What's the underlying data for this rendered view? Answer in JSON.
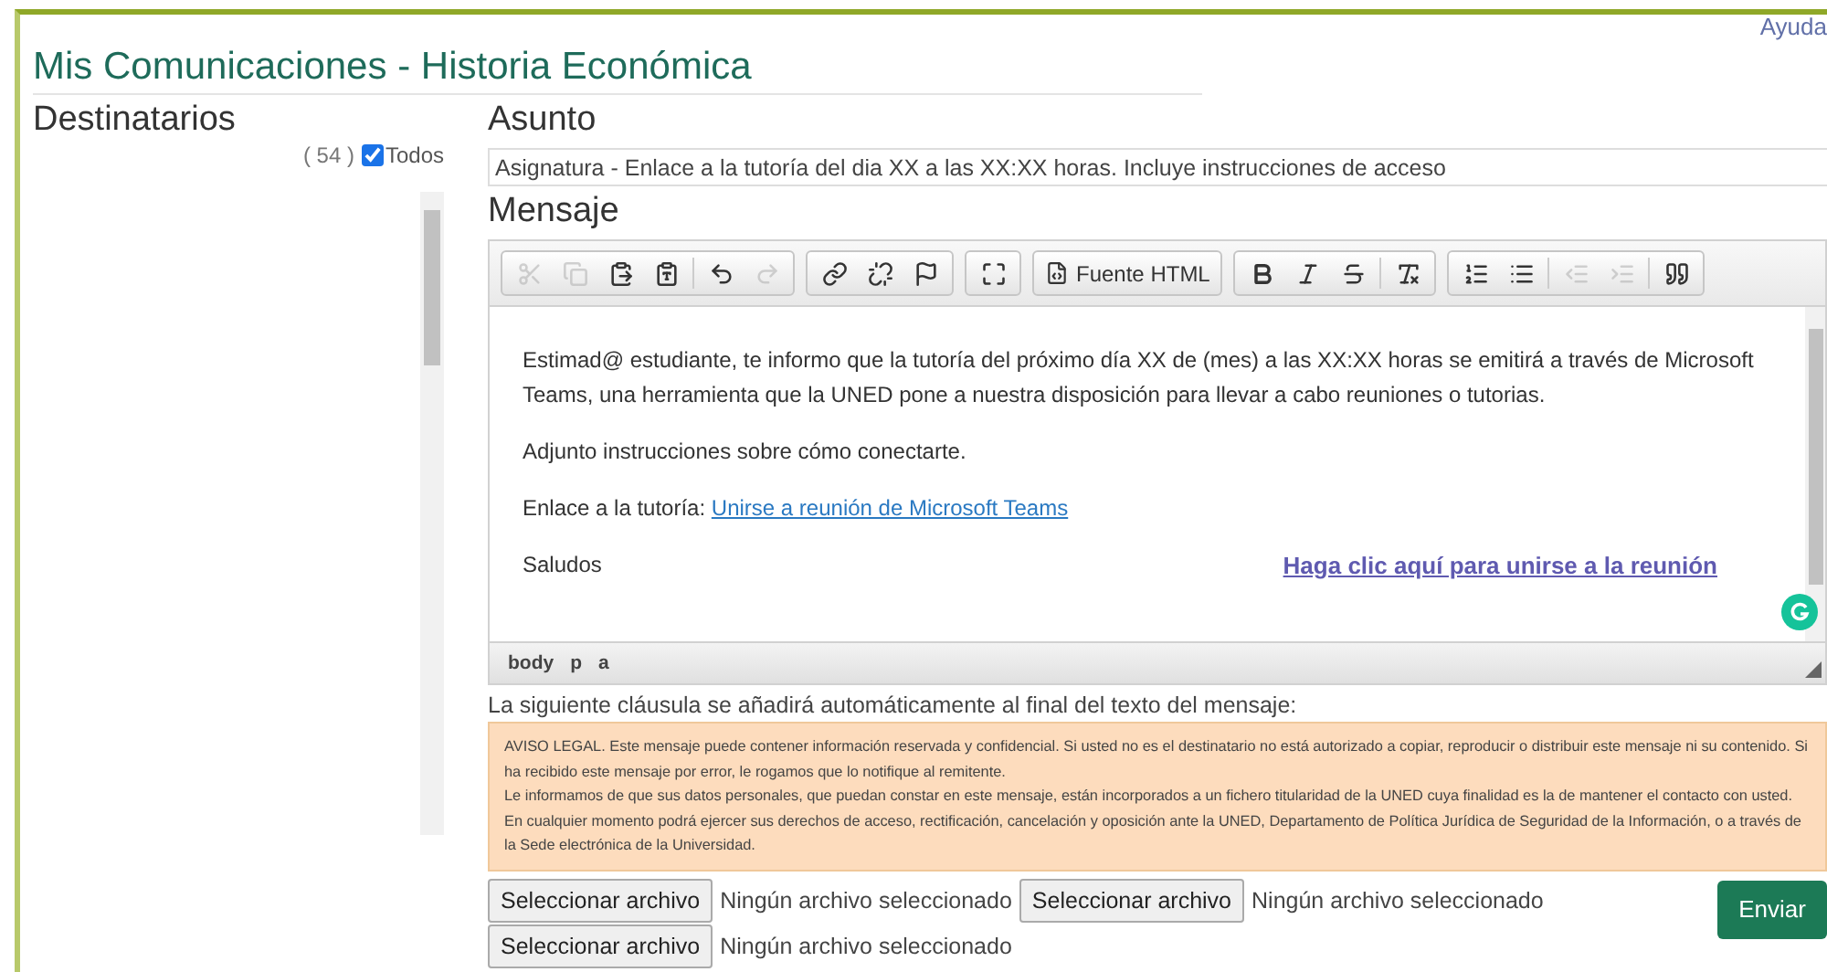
{
  "help_link": "Ayuda",
  "title": "Mis Comunicaciones - Historia Económica",
  "recipients": {
    "heading": "Destinatarios",
    "count": "( 54 )",
    "select_all": {
      "label": "Todos",
      "checked": true
    }
  },
  "subject": {
    "heading": "Asunto",
    "value": "Asignatura - Enlace a la tutoría del dia XX a las XX:XX horas. Incluye instrucciones de acceso"
  },
  "message": {
    "heading": "Mensaje",
    "toolbar": [
      [
        {
          "kind": "cut",
          "disabled": true
        },
        {
          "kind": "copy",
          "disabled": true
        },
        {
          "kind": "paste",
          "disabled": false
        },
        {
          "kind": "pasteword",
          "disabled": false
        },
        {
          "kind": "sep"
        },
        {
          "kind": "undo",
          "disabled": false
        },
        {
          "kind": "redo",
          "disabled": true
        }
      ],
      [
        {
          "kind": "link",
          "disabled": false
        },
        {
          "kind": "unlink",
          "disabled": false
        },
        {
          "kind": "anchor",
          "disabled": false
        }
      ],
      [
        {
          "kind": "maximize",
          "disabled": false
        }
      ],
      [
        {
          "kind": "source",
          "label": "Fuente HTML",
          "disabled": false
        }
      ],
      [
        {
          "kind": "bold",
          "disabled": false
        },
        {
          "kind": "italic",
          "disabled": false
        },
        {
          "kind": "strike",
          "disabled": false
        },
        {
          "kind": "sep"
        },
        {
          "kind": "clearformat",
          "disabled": false
        }
      ],
      [
        {
          "kind": "numbered",
          "disabled": false
        },
        {
          "kind": "bulleted",
          "disabled": false
        },
        {
          "kind": "sep"
        },
        {
          "kind": "outdent",
          "disabled": true
        },
        {
          "kind": "indent",
          "disabled": true
        },
        {
          "kind": "sep"
        },
        {
          "kind": "quote",
          "disabled": false
        }
      ]
    ],
    "paragraphs": [
      {
        "text": "Estimad@ estudiante, te informo que la tutoría del próximo día XX de (mes) a las XX:XX horas se emitirá a través de  Microsoft Teams, una herramienta que la UNED pone a nuestra disposición para llevar a cabo reuniones o tutorias."
      },
      {
        "text": "Adjunto instrucciones sobre cómo conectarte."
      },
      {
        "text": "Enlace a la tutoría:",
        "link": "Unirse a reunión de Microsoft Teams"
      },
      {
        "text": "Saludos",
        "join_link": "Haga clic aquí para unirse a la reunión"
      }
    ],
    "path": [
      "body",
      "p",
      "a"
    ]
  },
  "clause_note": "La siguiente cláusula se añadirá automáticamente al final del texto del mensaje:",
  "legal": [
    "AVISO LEGAL. Este mensaje puede contener información reservada y confidencial. Si usted no es el destinatario no está autorizado a copiar, reproducir o distribuir este mensaje ni su contenido. Si ha recibido este mensaje por error, le rogamos que lo notifique al remitente.",
    "Le informamos de que sus datos personales, que puedan constar en este mensaje, están incorporados a un fichero titularidad de la UNED cuya finalidad es la de mantener el contacto con usted. En cualquier momento podrá ejercer sus derechos de acceso, rectificación, cancelación y oposición ante la UNED, Departamento de Política Jurídica de Seguridad de la Información, o a través de la Sede electrónica de la Universidad."
  ],
  "attachments": [
    {
      "button": "Seleccionar archivo",
      "status": "Ningún archivo seleccionado"
    },
    {
      "button": "Seleccionar archivo",
      "status": "Ningún archivo seleccionado"
    },
    {
      "button": "Seleccionar archivo",
      "status": "Ningún archivo seleccionado"
    }
  ],
  "send_button": "Enviar"
}
